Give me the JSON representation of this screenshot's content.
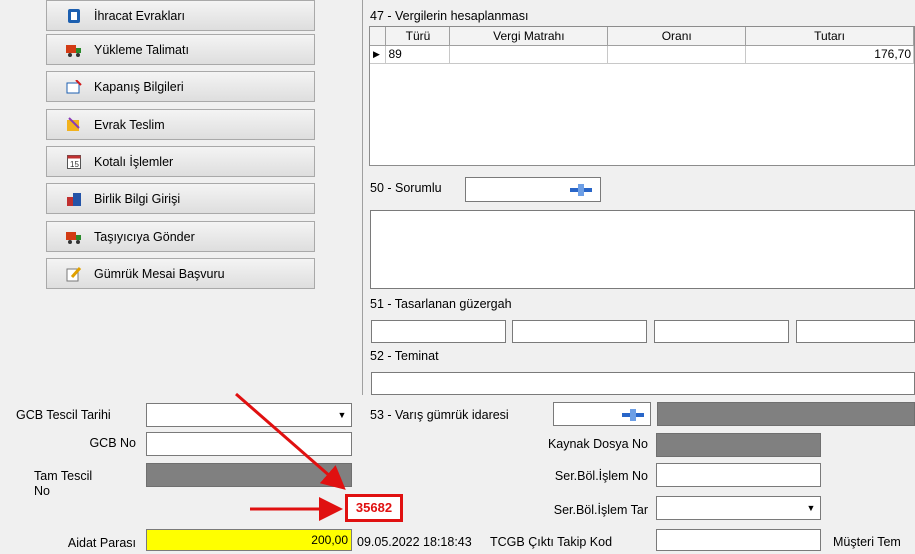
{
  "nav_buttons": [
    {
      "label": "İhracat Evrakları",
      "icon": "export-documents-icon"
    },
    {
      "label": "Yükleme Talimatı",
      "icon": "truck-icon"
    },
    {
      "label": "Kapanış Bilgileri",
      "icon": "closing-info-icon"
    },
    {
      "label": "Evrak Teslim",
      "icon": "document-delivery-icon"
    },
    {
      "label": "Kotalı İşlemler",
      "icon": "calendar-icon"
    },
    {
      "label": "Birlik Bilgi Girişi",
      "icon": "database-icon"
    },
    {
      "label": "Taşıyıcıya Gönder",
      "icon": "truck-icon"
    },
    {
      "label": "Gümrük Mesai Başvuru",
      "icon": "edit-icon"
    }
  ],
  "tax": {
    "title": "47 - Vergilerin hesaplanması",
    "columns": [
      "Türü",
      "Vergi Matrahı",
      "Oranı",
      "Tutarı"
    ],
    "rows": [
      [
        "89",
        "",
        "",
        "176,70"
      ]
    ]
  },
  "sorumlu": {
    "label": "50 - Sorumlu",
    "value": ""
  },
  "route": {
    "label": "51 - Tasarlanan güzergah"
  },
  "teminat": {
    "label": "52 - Teminat"
  },
  "varis": {
    "label": "53 - Varış gümrük idaresi"
  },
  "left_form": {
    "gcb_tescil_tarihi": "GCB Tescil Tarihi",
    "gcb_no": "GCB No",
    "tam_tescil_no": "Tam Tescil\nNo",
    "aidat_parasi": "Aidat Parası",
    "aidat_value": "200,00",
    "timestamp": "09.05.2022 18:18:43"
  },
  "right_form": {
    "kaynak_dosya_no": "Kaynak Dosya No",
    "ser_bol_islem_no": "Ser.Böl.İşlem No",
    "ser_bol_islem_tar": "Ser.Böl.İşlem Tar",
    "tcgb_cikti": "TCGB Çıktı Takip Kod",
    "musteri": "Müşteri Tem"
  },
  "annotation": {
    "value": "35682"
  },
  "colors": {
    "accent_yellow": "#ffff00",
    "annotation_red": "#e01010"
  }
}
